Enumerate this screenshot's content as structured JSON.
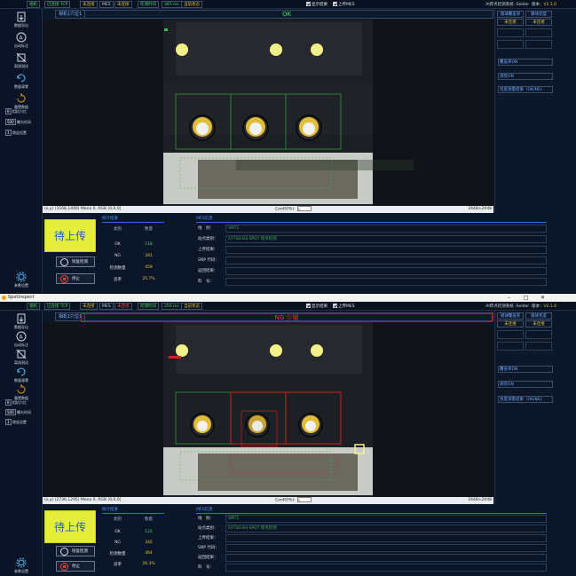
{
  "window2_title": "SpotInspect",
  "window_controls": [
    "–",
    "□",
    "✕"
  ],
  "topbar": {
    "items": [
      "相机",
      "已连接 TCP",
      "未连接",
      "MES",
      "未连接",
      "检测时间",
      "383 ms",
      "当前状态"
    ],
    "items_p2": [
      "相机",
      "已连接 TCP",
      "未连接",
      "MES",
      "未连接",
      "检测时间",
      "350 ms",
      "当前状态"
    ],
    "show_result": "显示结果",
    "upload_mes": "上传MES",
    "app_name": "AI焊点检测系统 -Solder",
    "version_label": "版本：",
    "version": "V2.1.0"
  },
  "sidebar": {
    "items": [
      {
        "label": "数据导出",
        "icon": "export-icon"
      },
      {
        "label": "自动标注",
        "icon": "auto-annotate-icon"
      },
      {
        "label": "离线测试",
        "icon": "offline-test-icon"
      },
      {
        "label": "数量清零",
        "icon": "reset-count-icon"
      },
      {
        "label": "重置数据",
        "icon": "reset-data-icon"
      }
    ],
    "num1": "0",
    "num1_label": "相机穴位",
    "num2": "500",
    "num2_label": "曝光时间",
    "num3": "1",
    "num3_label": "增益设置",
    "settings": "参数设置"
  },
  "panel1": {
    "camera_label": "相机1穴位1",
    "status": "OK",
    "coords": "(x,y) (3168,1440) Mono 0, RGB (0,0,0)",
    "conf_label": "Conf(0%):",
    "conf_value": "0",
    "resolution": "2448×2048",
    "stats": {
      "title": "统计结果",
      "hdr_k": "类别",
      "hdr_v": "数量",
      "ok": "118",
      "ng": "341",
      "total": "459",
      "rate": "25.7%"
    },
    "upload_btn": "待上传"
  },
  "panel2": {
    "camera_label": "相机1穴位1",
    "status": "NG 少锡",
    "coords": "(x,y) (2736,1295) Mono 0, RGB (0,0,0)",
    "conf_label": "Conf(0%):",
    "conf_value": "0",
    "resolution": "2448×2048",
    "stats": {
      "title": "统计结果",
      "hdr_k": "类别",
      "hdr_v": "数量",
      "ok": "122",
      "ng": "342",
      "total": "464",
      "rate": "26.3%"
    },
    "upload_btn": "待上传"
  },
  "labels": {
    "ok": "OK",
    "ng": "NG",
    "total": "检测数量",
    "rate": "良率",
    "resume": "恢复检测",
    "stop": "停止",
    "mes_title": "MES信息",
    "mes_rows": [
      "线　别：",
      "站点类别：",
      "上传结果：",
      "SNP 代码：",
      "返回结果：",
      "料　号："
    ],
    "mes_line": "SMT1",
    "mes_site": "SYTSD-B4 SPOT 焊点检测"
  },
  "rightpanel": {
    "head1": "锡球覆盖率",
    "head2": "锡球亮度",
    "val1": "未连接",
    "val2": "未连接",
    "label1": "覆盖率ON",
    "label2": "测亮ON",
    "label3": "亮度测量结果（OK/NG）"
  },
  "colors": {
    "ok_green": "#28e05a",
    "ng_red": "#ff2d2d",
    "upload_yellow": "#e6ee3c",
    "accent_blue": "#4f93ff"
  }
}
